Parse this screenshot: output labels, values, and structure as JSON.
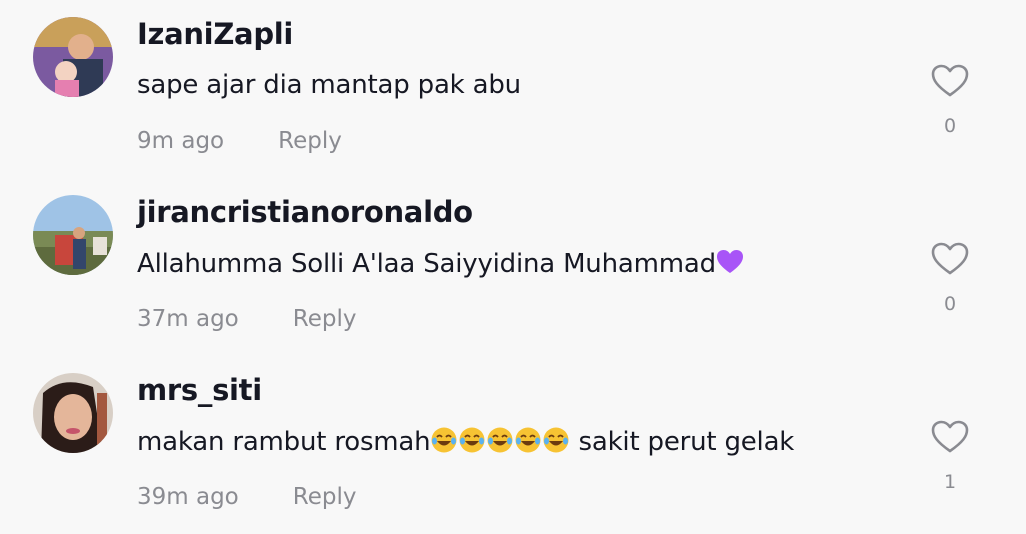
{
  "comments": [
    {
      "username": "IzaniZapli",
      "text": "sape ajar dia mantap pak abu",
      "time": "9m ago",
      "reply_label": "Reply",
      "likes": "0",
      "avatar_icon": "user-avatar-photo"
    },
    {
      "username": "jirancristianoronaldo",
      "text_before_emoji": "Allahumma Solli A'laa Saiyyidina Muhammad",
      "emoji": "purple-heart",
      "time": "37m ago",
      "reply_label": "Reply",
      "likes": "0",
      "avatar_icon": "user-avatar-photo"
    },
    {
      "username": "mrs_siti",
      "text_before_emoji": "makan rambut rosmah",
      "emoji": "face-with-tears-of-joy",
      "emoji_count": 5,
      "text_after_emoji": " sakit perut gelak",
      "time": "39m ago",
      "reply_label": "Reply",
      "likes": "1",
      "avatar_icon": "user-avatar-photo"
    }
  ],
  "colors": {
    "background": "#f8f8f8",
    "username": "#161823",
    "text": "#161823",
    "meta": "#8a8b91",
    "heart_outline": "#8a8b91",
    "purple_heart": "#a855f7",
    "laugh_emoji": "#f7c333"
  }
}
